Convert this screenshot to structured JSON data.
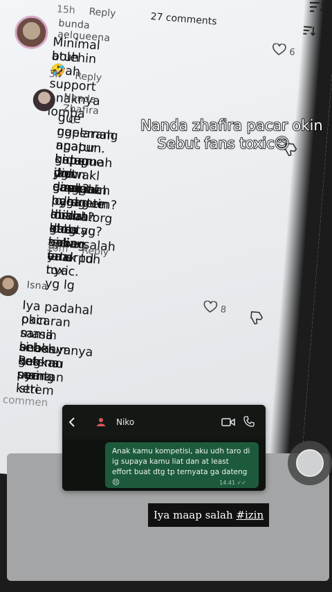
{
  "header": {
    "comments_count": "27 comments",
    "top_time": "15h",
    "top_reply": "Reply"
  },
  "comments": [
    {
      "username": "bunda aelqueena",
      "text_lines": [
        "Minimal bolehin ayah support anaknya lomba",
        "atuh🤣"
      ],
      "time": "3h",
      "reply": "Reply",
      "likes": "6"
    },
    {
      "username": "Nanda Zhafira · C",
      "text_lines": [
        "gue gapernah ngatur hidup dia. gapernah",
        "ngelarang apapun. gapernah ikut campur",
        "apapun. knp gue yg disalahin pdhl gue",
        "gatau jadwal anak2 nya lomba? dan tau",
        "drmn kl gue gak ngingetin disaat gue tau?",
        "emg lo ga mikir kl bs aja ortu nya yg lg",
        "berantem? ahahah emg paling enak tuh",
        "nuduh org baru yg gabersalah ya drpd",
        "idola kalian. fans toxic."
      ],
      "time": "10m",
      "reply": "Reply"
    },
    {
      "username": "Isna",
      "text_lines": [
        "Iya padahal pacaran sama sebelumnya",
        "okin masih bebas ketemu mantan istri",
        "sama anaknya bahkan sering",
        "si Regina nya ketem",
        "gak perna"
      ],
      "likes": "8"
    }
  ],
  "add_comment_placeholder": "d commen",
  "overlay": {
    "line1": "Nanda zhafira pacar okin",
    "line2": "Sebut fans toxic😌"
  },
  "chat": {
    "contact_name": "Niko",
    "message": "Anak kamu kompetisi, aku udh taro di ig supaya kamu liat dan at least effort buat dtg tp ternyata ga dateng",
    "emoji": "😣",
    "time": "14.41 ✓✓"
  },
  "caption": {
    "text": "Iya maap salah ",
    "hashtag": "#izin"
  }
}
